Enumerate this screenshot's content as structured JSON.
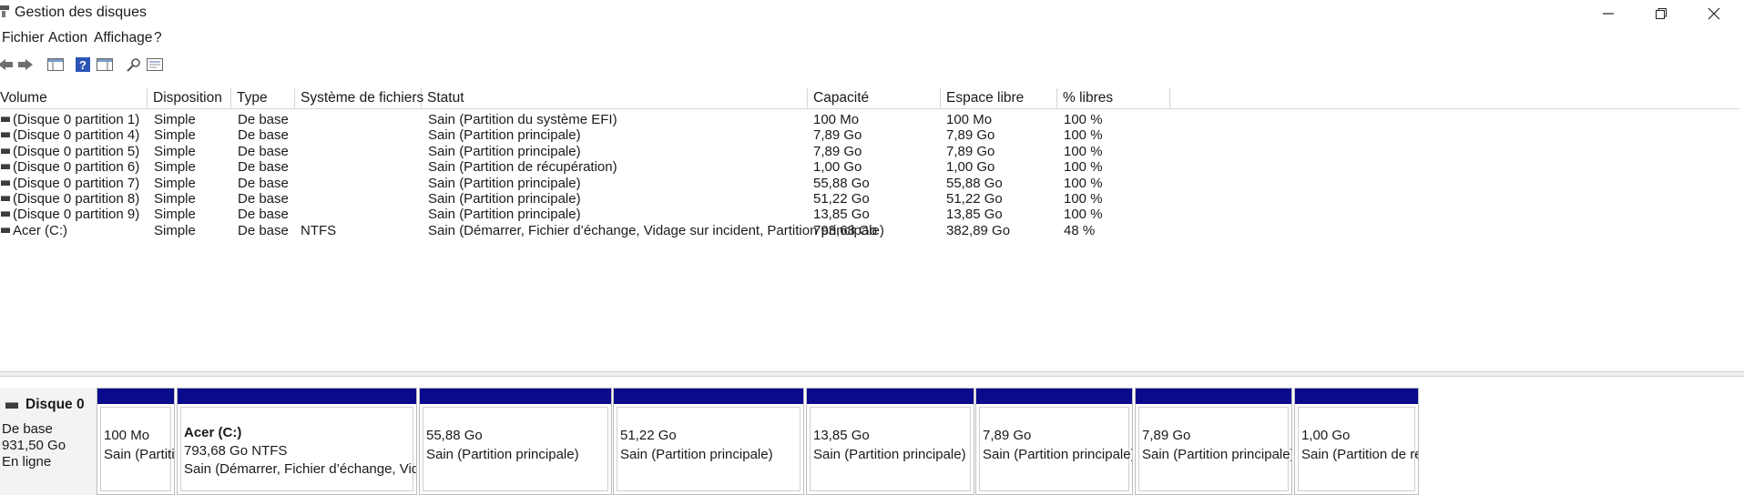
{
  "window": {
    "title": "Gestion des disques"
  },
  "menu": [
    "Fichier",
    "Action",
    "Affichage",
    "?"
  ],
  "toolbar": {
    "icons": [
      "back-arrow-icon",
      "forward-arrow-icon",
      "console-tree-icon",
      "help-icon",
      "action-pane-icon",
      "rescan-icon",
      "properties-icon"
    ]
  },
  "table": {
    "columns": [
      "Volume",
      "Disposition",
      "Type",
      "Système de fichiers",
      "Statut",
      "Capacité",
      "Espace libre",
      "% libres"
    ],
    "rows": [
      [
        "(Disque 0 partition 1)",
        "Simple",
        "De base",
        "",
        "Sain (Partition du système EFI)",
        "100 Mo",
        "100 Mo",
        "100 %"
      ],
      [
        "(Disque 0 partition 4)",
        "Simple",
        "De base",
        "",
        "Sain (Partition principale)",
        "7,89 Go",
        "7,89 Go",
        "100 %"
      ],
      [
        "(Disque 0 partition 5)",
        "Simple",
        "De base",
        "",
        "Sain (Partition principale)",
        "7,89 Go",
        "7,89 Go",
        "100 %"
      ],
      [
        "(Disque 0 partition 6)",
        "Simple",
        "De base",
        "",
        "Sain (Partition de récupération)",
        "1,00 Go",
        "1,00 Go",
        "100 %"
      ],
      [
        "(Disque 0 partition 7)",
        "Simple",
        "De base",
        "",
        "Sain (Partition principale)",
        "55,88 Go",
        "55,88 Go",
        "100 %"
      ],
      [
        "(Disque 0 partition 8)",
        "Simple",
        "De base",
        "",
        "Sain (Partition principale)",
        "51,22 Go",
        "51,22 Go",
        "100 %"
      ],
      [
        "(Disque 0 partition 9)",
        "Simple",
        "De base",
        "",
        "Sain (Partition principale)",
        "13,85 Go",
        "13,85 Go",
        "100 %"
      ],
      [
        "Acer (C:)",
        "Simple",
        "De base",
        "NTFS",
        "Sain (Démarrer, Fichier d’échange, Vidage sur incident, Partition principale)",
        "793,68 Go",
        "382,89 Go",
        "48 %"
      ]
    ]
  },
  "disk": {
    "name": "Disque 0",
    "type": "De base",
    "size": "931,50 Go",
    "state": "En ligne",
    "partitions": [
      {
        "name": "",
        "size": "100 Mo",
        "status": "Sain (Partitior"
      },
      {
        "name": "Acer  (C:)",
        "size": "793,68 Go NTFS",
        "status": "Sain (Démarrer, Fichier d’échange, Vidage sur"
      },
      {
        "name": "",
        "size": "55,88 Go",
        "status": "Sain (Partition principale)"
      },
      {
        "name": "",
        "size": "51,22 Go",
        "status": "Sain (Partition principale)"
      },
      {
        "name": "",
        "size": "13,85 Go",
        "status": "Sain (Partition principale)"
      },
      {
        "name": "",
        "size": "7,89 Go",
        "status": "Sain (Partition principale)"
      },
      {
        "name": "",
        "size": "7,89 Go",
        "status": "Sain (Partition principale)"
      },
      {
        "name": "",
        "size": "1,00 Go",
        "status": "Sain (Partition de récu|"
      }
    ]
  }
}
